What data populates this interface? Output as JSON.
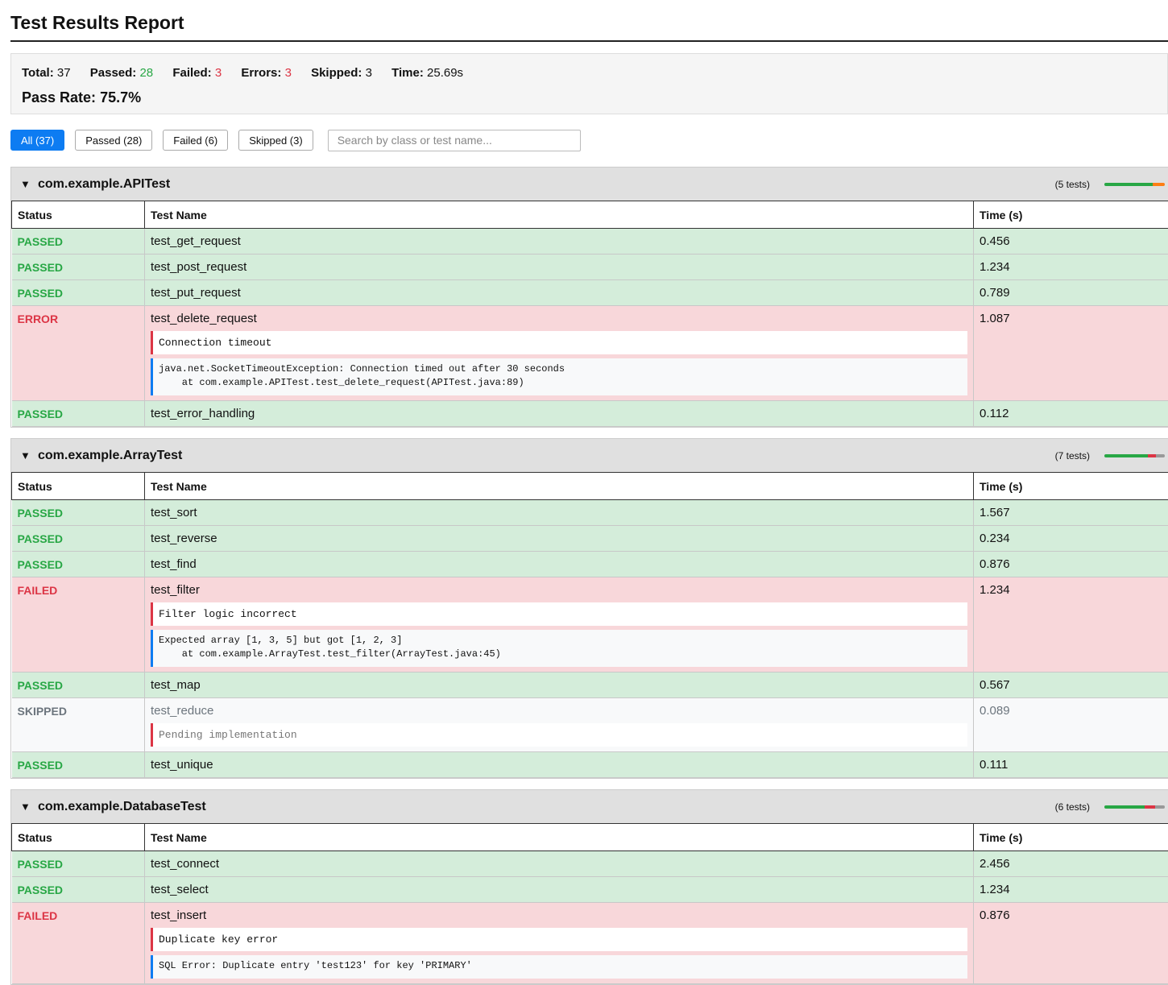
{
  "title": "Test Results Report",
  "summary": {
    "total_label": "Total:",
    "total": "37",
    "passed_label": "Passed:",
    "passed": "28",
    "failed_label": "Failed:",
    "failed": "3",
    "errors_label": "Errors:",
    "errors": "3",
    "skipped_label": "Skipped:",
    "skipped": "3",
    "time_label": "Time:",
    "time": "25.69s",
    "pass_rate_label": "Pass Rate:",
    "pass_rate": "75.7%"
  },
  "filters": {
    "all": "All (37)",
    "passed": "Passed (28)",
    "failed": "Failed (6)",
    "skipped": "Skipped (3)",
    "search_placeholder": "Search by class or test name..."
  },
  "table_headers": {
    "status": "Status",
    "name": "Test Name",
    "time": "Time (s)"
  },
  "colors": {
    "passed": "#28a745",
    "failed": "#dc3545",
    "skipped": "#999999",
    "error": "#fd7e14",
    "active": "#0d7cf2"
  },
  "suites": [
    {
      "name": "com.example.APITest",
      "count": "(5 tests)",
      "toggle": "▼",
      "bar": [
        {
          "type": "passed",
          "fraction": 0.8
        },
        {
          "type": "error",
          "fraction": 0.2
        }
      ],
      "tests": [
        {
          "status": "PASSED",
          "name": "test_get_request",
          "time": "0.456"
        },
        {
          "status": "PASSED",
          "name": "test_post_request",
          "time": "1.234"
        },
        {
          "status": "PASSED",
          "name": "test_put_request",
          "time": "0.789"
        },
        {
          "status": "ERROR",
          "name": "test_delete_request",
          "time": "1.087",
          "message": "Connection timeout",
          "trace": "java.net.SocketTimeoutException: Connection timed out after 30 seconds\n    at com.example.APITest.test_delete_request(APITest.java:89)"
        },
        {
          "status": "PASSED",
          "name": "test_error_handling",
          "time": "0.112"
        }
      ]
    },
    {
      "name": "com.example.ArrayTest",
      "count": "(7 tests)",
      "toggle": "▼",
      "bar": [
        {
          "type": "passed",
          "fraction": 0.714
        },
        {
          "type": "failed",
          "fraction": 0.143
        },
        {
          "type": "skipped",
          "fraction": 0.143
        }
      ],
      "tests": [
        {
          "status": "PASSED",
          "name": "test_sort",
          "time": "1.567"
        },
        {
          "status": "PASSED",
          "name": "test_reverse",
          "time": "0.234"
        },
        {
          "status": "PASSED",
          "name": "test_find",
          "time": "0.876"
        },
        {
          "status": "FAILED",
          "name": "test_filter",
          "time": "1.234",
          "message": "Filter logic incorrect",
          "trace": "Expected array [1, 3, 5] but got [1, 2, 3]\n    at com.example.ArrayTest.test_filter(ArrayTest.java:45)"
        },
        {
          "status": "PASSED",
          "name": "test_map",
          "time": "0.567"
        },
        {
          "status": "SKIPPED",
          "name": "test_reduce",
          "time": "0.089",
          "message": "Pending implementation"
        },
        {
          "status": "PASSED",
          "name": "test_unique",
          "time": "0.111"
        }
      ]
    },
    {
      "name": "com.example.DatabaseTest",
      "count": "(6 tests)",
      "toggle": "▼",
      "bar": [
        {
          "type": "passed",
          "fraction": 0.667
        },
        {
          "type": "failed",
          "fraction": 0.167
        },
        {
          "type": "skipped",
          "fraction": 0.166
        }
      ],
      "tests": [
        {
          "status": "PASSED",
          "name": "test_connect",
          "time": "2.456"
        },
        {
          "status": "PASSED",
          "name": "test_select",
          "time": "1.234"
        },
        {
          "status": "FAILED",
          "name": "test_insert",
          "time": "0.876",
          "message": "Duplicate key error",
          "trace": "SQL Error: Duplicate entry 'test123' for key 'PRIMARY'"
        }
      ]
    }
  ]
}
